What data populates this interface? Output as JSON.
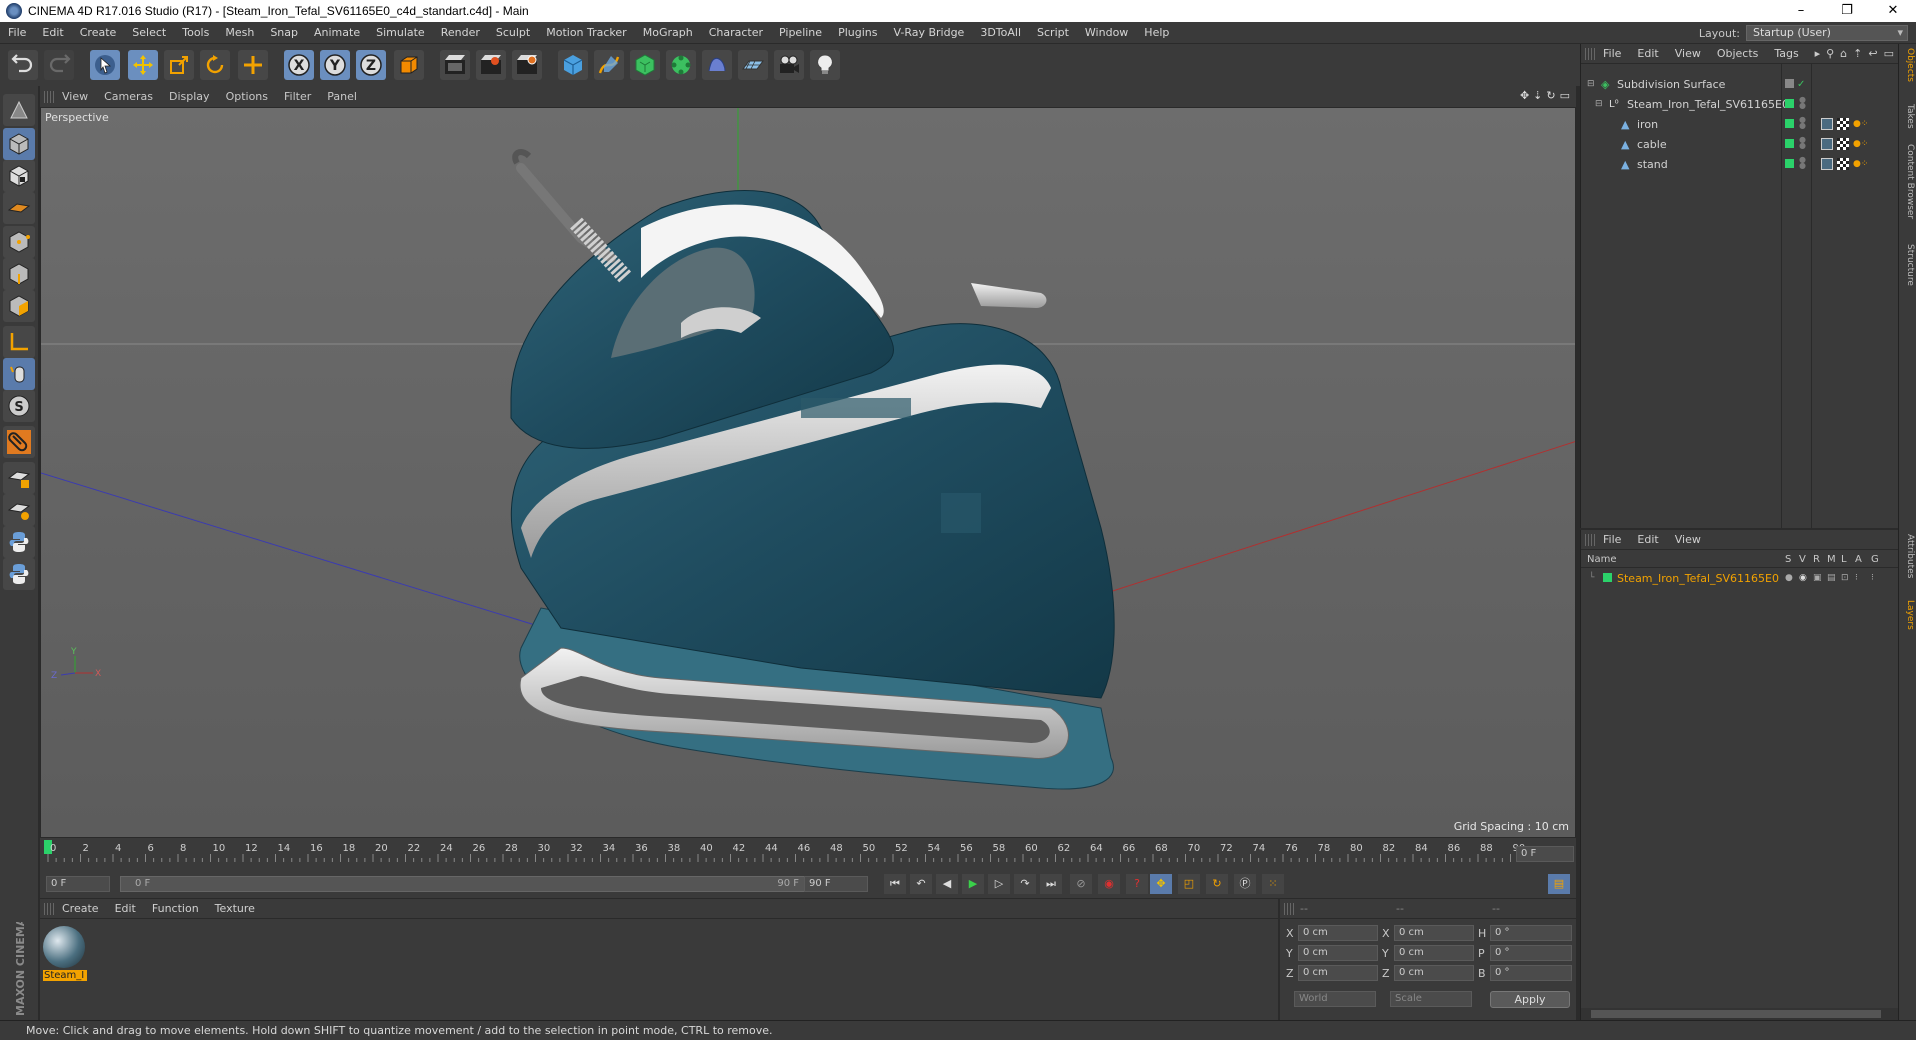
{
  "window": {
    "title": "CINEMA 4D R17.016 Studio (R17) - [Steam_Iron_Tefal_SV61165E0_c4d_standart.c4d] - Main",
    "controls": [
      "–",
      "❐",
      "✕"
    ]
  },
  "menubar": {
    "items": [
      "File",
      "Edit",
      "Create",
      "Select",
      "Tools",
      "Mesh",
      "Snap",
      "Animate",
      "Simulate",
      "Render",
      "Sculpt",
      "Motion Tracker",
      "MoGraph",
      "Character",
      "Pipeline",
      "Plugins",
      "V-Ray Bridge",
      "3DToAll",
      "Script",
      "Window",
      "Help"
    ],
    "layout_label": "Layout:",
    "layout_value": "Startup (User)"
  },
  "toolbar": {
    "icons": [
      "undo-icon",
      "redo-icon",
      "select-arrow-icon",
      "move-icon",
      "scale-icon",
      "rotate-icon",
      "add-icon",
      "x-axis-icon",
      "y-axis-icon",
      "z-axis-icon",
      "coordinate-system-icon",
      "render-view-icon",
      "render-picture-viewer-icon",
      "render-settings-icon",
      "cube-icon",
      "pen-spline-icon",
      "subdivision-icon",
      "array-icon",
      "deformer-icon",
      "floor-icon",
      "camera-icon",
      "light-icon"
    ]
  },
  "viewport": {
    "menu": [
      "View",
      "Cameras",
      "Display",
      "Options",
      "Filter",
      "Panel"
    ],
    "label": "Perspective",
    "grid_spacing": "Grid Spacing : 10 cm",
    "accent_green": "#2bd26a"
  },
  "timeline": {
    "ticks": [
      "0",
      "2",
      "4",
      "6",
      "8",
      "10",
      "12",
      "14",
      "16",
      "18",
      "20",
      "22",
      "24",
      "26",
      "28",
      "30",
      "32",
      "34",
      "36",
      "38",
      "40",
      "42",
      "44",
      "46",
      "48",
      "50",
      "52",
      "54",
      "56",
      "58",
      "60",
      "62",
      "64",
      "66",
      "68",
      "70",
      "72",
      "74",
      "76",
      "78",
      "80",
      "82",
      "84",
      "86",
      "88",
      "90"
    ],
    "current_frame": "0 F",
    "start_field": "0 F",
    "range_start": "0 F",
    "range_end": "90 F",
    "end_field": "90 F"
  },
  "materials": {
    "menu": [
      "Create",
      "Edit",
      "Function",
      "Texture"
    ],
    "items": [
      {
        "label": "Steam_I"
      }
    ]
  },
  "coordinates": {
    "header": [
      "--",
      "--",
      "--"
    ],
    "rows": [
      {
        "a": "X",
        "av": "0 cm",
        "b": "X",
        "bv": "0 cm",
        "c": "H",
        "cv": "0 °"
      },
      {
        "a": "Y",
        "av": "0 cm",
        "b": "Y",
        "bv": "0 cm",
        "c": "P",
        "cv": "0 °"
      },
      {
        "a": "Z",
        "av": "0 cm",
        "b": "Z",
        "bv": "0 cm",
        "c": "B",
        "cv": "0 °"
      }
    ],
    "world": "World",
    "scale": "Scale",
    "apply": "Apply"
  },
  "objects": {
    "menu": [
      "File",
      "Edit",
      "View",
      "Objects",
      "Tags"
    ],
    "tree": [
      {
        "name": "Subdivision Surface",
        "depth": 0
      },
      {
        "name": "Steam_Iron_Tefal_SV61165E0",
        "depth": 1
      },
      {
        "name": "iron",
        "depth": 2
      },
      {
        "name": "cable",
        "depth": 2
      },
      {
        "name": "stand",
        "depth": 2
      }
    ]
  },
  "layers": {
    "menu": [
      "File",
      "Edit",
      "View"
    ],
    "columns": {
      "name": "Name",
      "flags": [
        "S",
        "V",
        "R",
        "M",
        "L",
        "A",
        "G"
      ]
    },
    "rows": [
      {
        "name": "Steam_Iron_Tefal_SV61165E0",
        "color": "#2bd26a"
      }
    ]
  },
  "side_tabs": [
    "Objects",
    "Takes",
    "Content Browser",
    "Structure",
    "Attributes",
    "Layers"
  ],
  "status": "Move: Click and drag to move elements. Hold down SHIFT to quantize movement / add to the selection in point mode, CTRL to remove.",
  "brand": "MAXON CINEMA 4D"
}
